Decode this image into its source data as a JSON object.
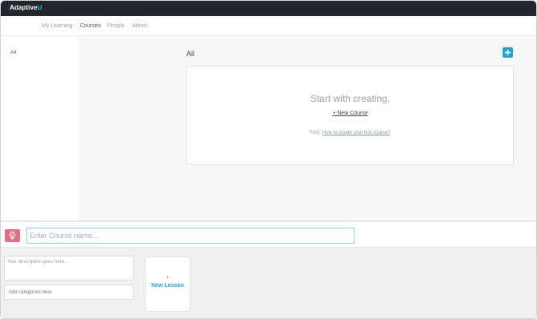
{
  "app": {
    "logo_text": "Adaptive",
    "logo_accent": "U",
    "accent_color": "#1ea6d9"
  },
  "nav": {
    "items": [
      {
        "label": "My Learning",
        "active": false
      },
      {
        "label": "Courses",
        "active": true
      },
      {
        "label": "People",
        "active": false
      },
      {
        "label": "Admin",
        "active": false
      }
    ]
  },
  "sidebar": {
    "items": [
      {
        "label": "All"
      }
    ]
  },
  "main": {
    "section_title": "All",
    "add_button_icon": "plus-icon",
    "empty_state": {
      "heading": "Start with creating,",
      "new_course_link": "+ New Course",
      "faq_prefix": "FAQ:",
      "faq_link": "How to create your first course?"
    }
  },
  "editor": {
    "course_icon": "location-pin-icon",
    "course_icon_color": "#e86c7d",
    "name_placeholder": "Enter Course name...",
    "description_placeholder": "Your description goes here...",
    "categories_placeholder": "Add categories here",
    "new_lesson_plus": "+",
    "new_lesson_label": "New Lesson"
  }
}
